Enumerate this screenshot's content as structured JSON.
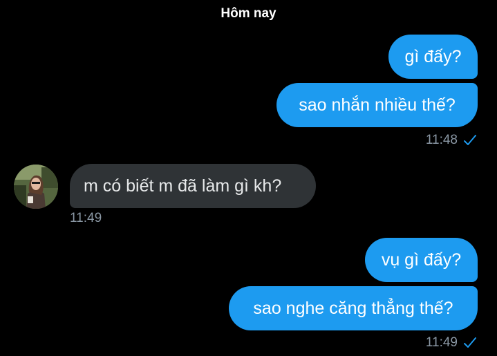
{
  "chat": {
    "date_divider": "Hôm nay",
    "outgoing_group_1": {
      "messages": [
        "gì đấy?",
        "sao nhắn nhiều thế?"
      ],
      "time": "11:48",
      "status_icon": "sent-check-icon"
    },
    "incoming_group": {
      "avatar_icon": "contact-avatar",
      "messages": [
        "m có biết m đã làm gì kh?"
      ],
      "time": "11:49"
    },
    "outgoing_group_2": {
      "messages": [
        "vụ gì đấy?",
        "sao nghe căng thẳng thế?"
      ],
      "time": "11:49",
      "status_icon": "sent-check-icon"
    }
  },
  "colors": {
    "background": "#000000",
    "outgoing_bubble": "#1d9bf0",
    "incoming_bubble": "#2f3336",
    "timestamp": "#8b98a5"
  }
}
